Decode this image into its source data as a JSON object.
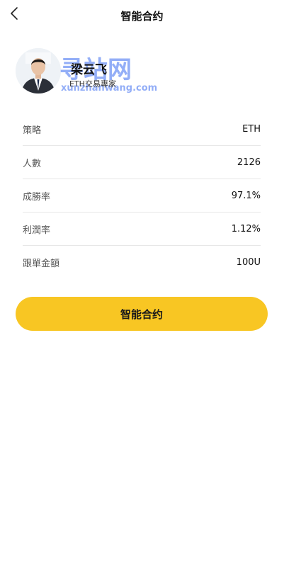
{
  "header": {
    "title": "智能合约",
    "back_icon": "chevron-left-icon"
  },
  "profile": {
    "name": "梁云飞",
    "subtitle": "ETH交易專家",
    "avatar_icon": "person-photo-avatar"
  },
  "watermark": {
    "main": "寻站网",
    "url": "xunzhanwang.com"
  },
  "info": [
    {
      "label": "策略",
      "value": "ETH"
    },
    {
      "label": "人數",
      "value": "2126"
    },
    {
      "label": "成勝率",
      "value": "97.1%"
    },
    {
      "label": "利潤率",
      "value": "1.12%"
    },
    {
      "label": "跟單金額",
      "value": "100U"
    }
  ],
  "action": {
    "label": "智能合约"
  },
  "colors": {
    "accent": "#f8c623",
    "divider": "#e7e7e7"
  }
}
